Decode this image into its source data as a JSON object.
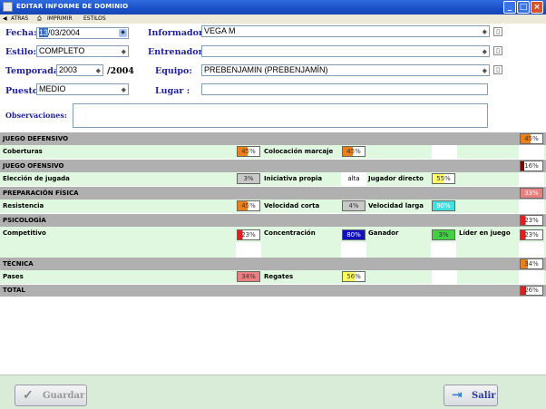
{
  "window": {
    "title": "EDITAR INFORME DE DOMINIO"
  },
  "toolbar": {
    "back": "ATRAS",
    "print": "IMPRIMIR",
    "styles": "ESTILOS"
  },
  "form": {
    "fecha_label": "Fecha:",
    "fecha_day": "13",
    "fecha_rest": "/03/2004",
    "estilo_label": "Estilo:",
    "estilo_value": "COMPLETO",
    "temporada_label": "Temporada:",
    "temporada_value": "2003",
    "temporada_end": "/2004",
    "puesto_label": "Puesto:",
    "puesto_value": "MEDIO",
    "informador_label": "Informador:",
    "informador_value": "VEGA M",
    "entrenador_label": "Entrenador:",
    "entrenador_value": "",
    "equipo_label": "Equipo:",
    "equipo_value": "PREBENJAMIN (PREBENJAMÍN)",
    "lugar_label": "Lugar :",
    "lugar_value": "",
    "observaciones_label": "Observaciones:",
    "observaciones_value": ""
  },
  "grid": {
    "defensivo": {
      "title": "JUEGO DEFENSIVO",
      "total": "45%",
      "coberturas_label": "Coberturas",
      "coberturas_value": "45%",
      "colocacion_label": "Colocación marcaje",
      "colocacion_value": "45%"
    },
    "ofensivo": {
      "title": "JUEGO OFENSIVO",
      "total": "16%",
      "eleccion_label": "Elección de jugada",
      "eleccion_value": "3%",
      "iniciativa_label": "Iniciativa propia",
      "iniciativa_value": "alta",
      "directo_label": "Jugador directo",
      "directo_value": "55%"
    },
    "fisica": {
      "title": "PREPARACIÓN FÍSICA",
      "total": "33%",
      "resistencia_label": "Resistencia",
      "resistencia_value": "45%",
      "vcorta_label": "Velocidad corta",
      "vcorta_value": "4%",
      "vlarga_label": "Velocidad larga",
      "vlarga_value": "90%"
    },
    "psicologia": {
      "title": "PSICOLOGÍA",
      "total": "23%",
      "competitivo_label": "Competitivo",
      "competitivo_value": "23%",
      "concentracion_label": "Concentración",
      "concentracion_value": "80%",
      "ganador_label": "Ganador",
      "ganador_value": "3%",
      "lider_label": "Líder en juego",
      "lider_value": "23%"
    },
    "tecnica": {
      "title": "TÉCNICA",
      "total": "34%",
      "pases_label": "Pases",
      "pases_value": "34%",
      "regates_label": "Regates",
      "regates_value": "56%"
    },
    "total_label": "TOTAL",
    "total_value": "26%"
  },
  "buttons": {
    "guardar": "Guardar",
    "salir": "Salir"
  },
  "colors": {
    "orange": "#e88020",
    "gray": "#c8c8c8",
    "yellow": "#ffff60",
    "cyan": "#40e0e0",
    "red": "#e02020",
    "darkred": "#800000",
    "blue": "#1010c0",
    "green": "#40d040",
    "pink": "#e88080"
  }
}
